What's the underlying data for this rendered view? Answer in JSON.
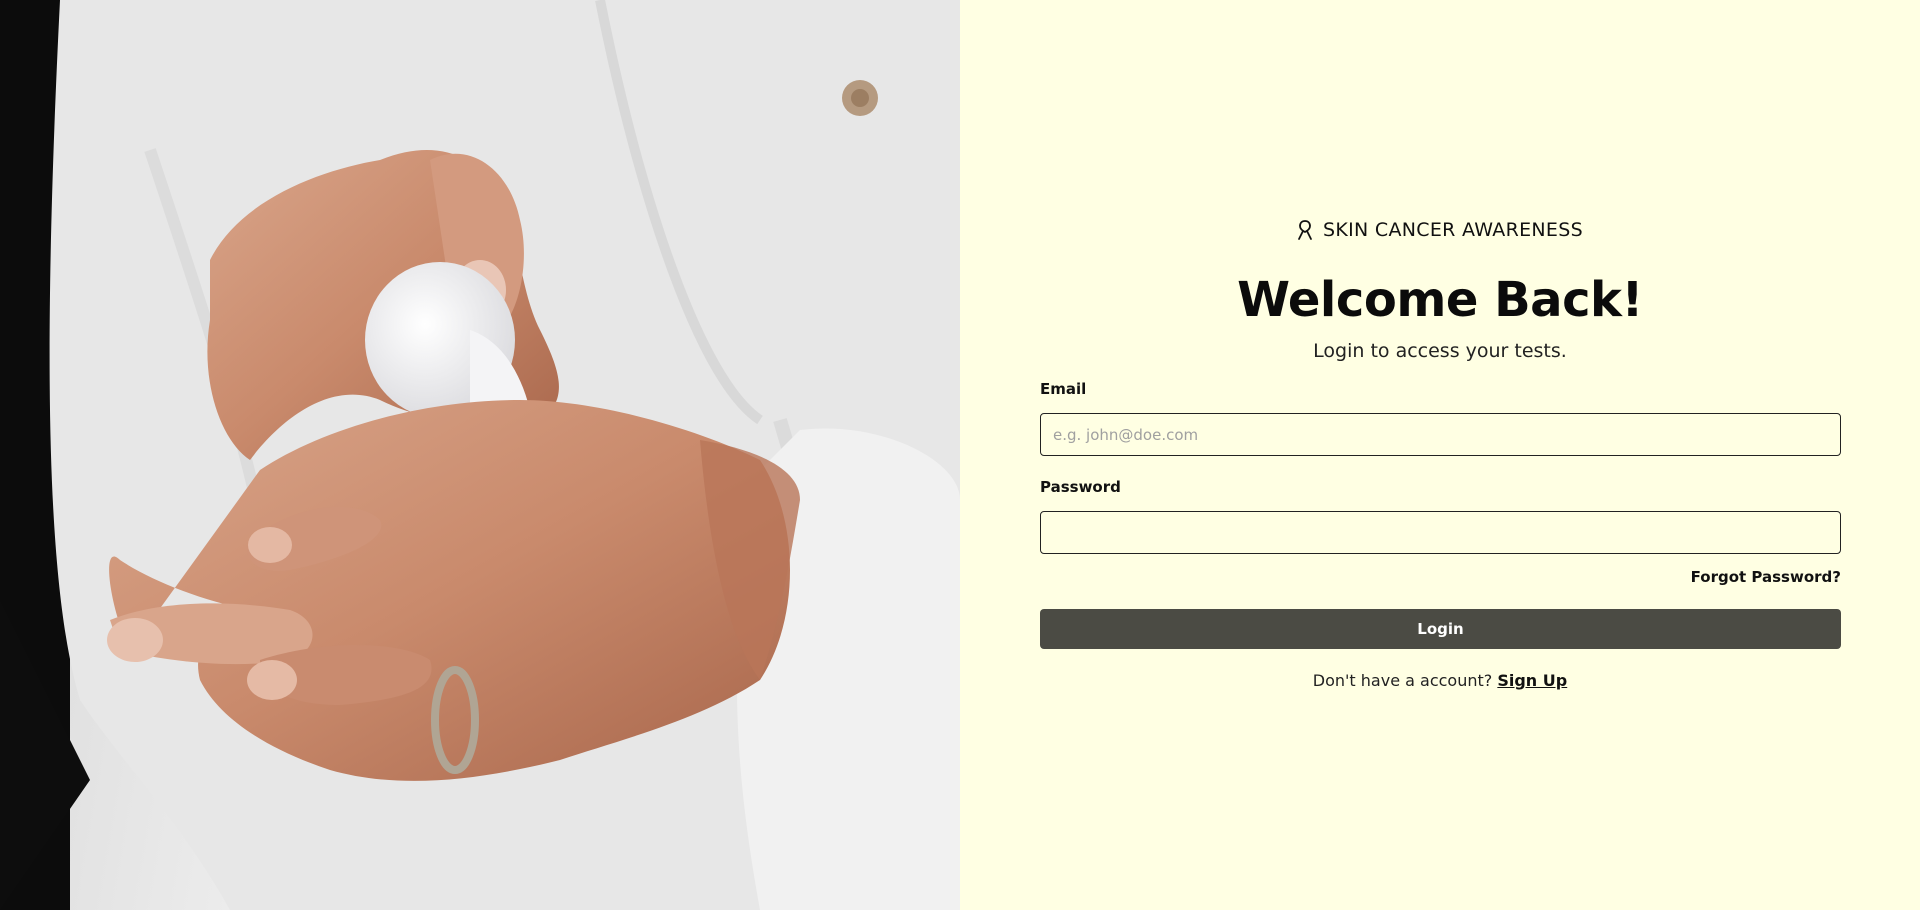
{
  "brand": {
    "icon": "awareness-ribbon-icon",
    "name": "SKIN CANCER AWARENESS"
  },
  "heading": {
    "title": "Welcome Back!",
    "subtitle": "Login to access your tests."
  },
  "form": {
    "email": {
      "label": "Email",
      "placeholder": "e.g. john@doe.com",
      "value": ""
    },
    "password": {
      "label": "Password",
      "placeholder": "",
      "value": ""
    },
    "forgot_label": "Forgot Password?",
    "login_label": "Login"
  },
  "signup": {
    "prompt": "Don't have a account?",
    "link_label": "Sign Up"
  },
  "colors": {
    "panel_bg": "#ffffe3",
    "button_bg": "#4b4b44",
    "button_text": "#ffffff"
  }
}
